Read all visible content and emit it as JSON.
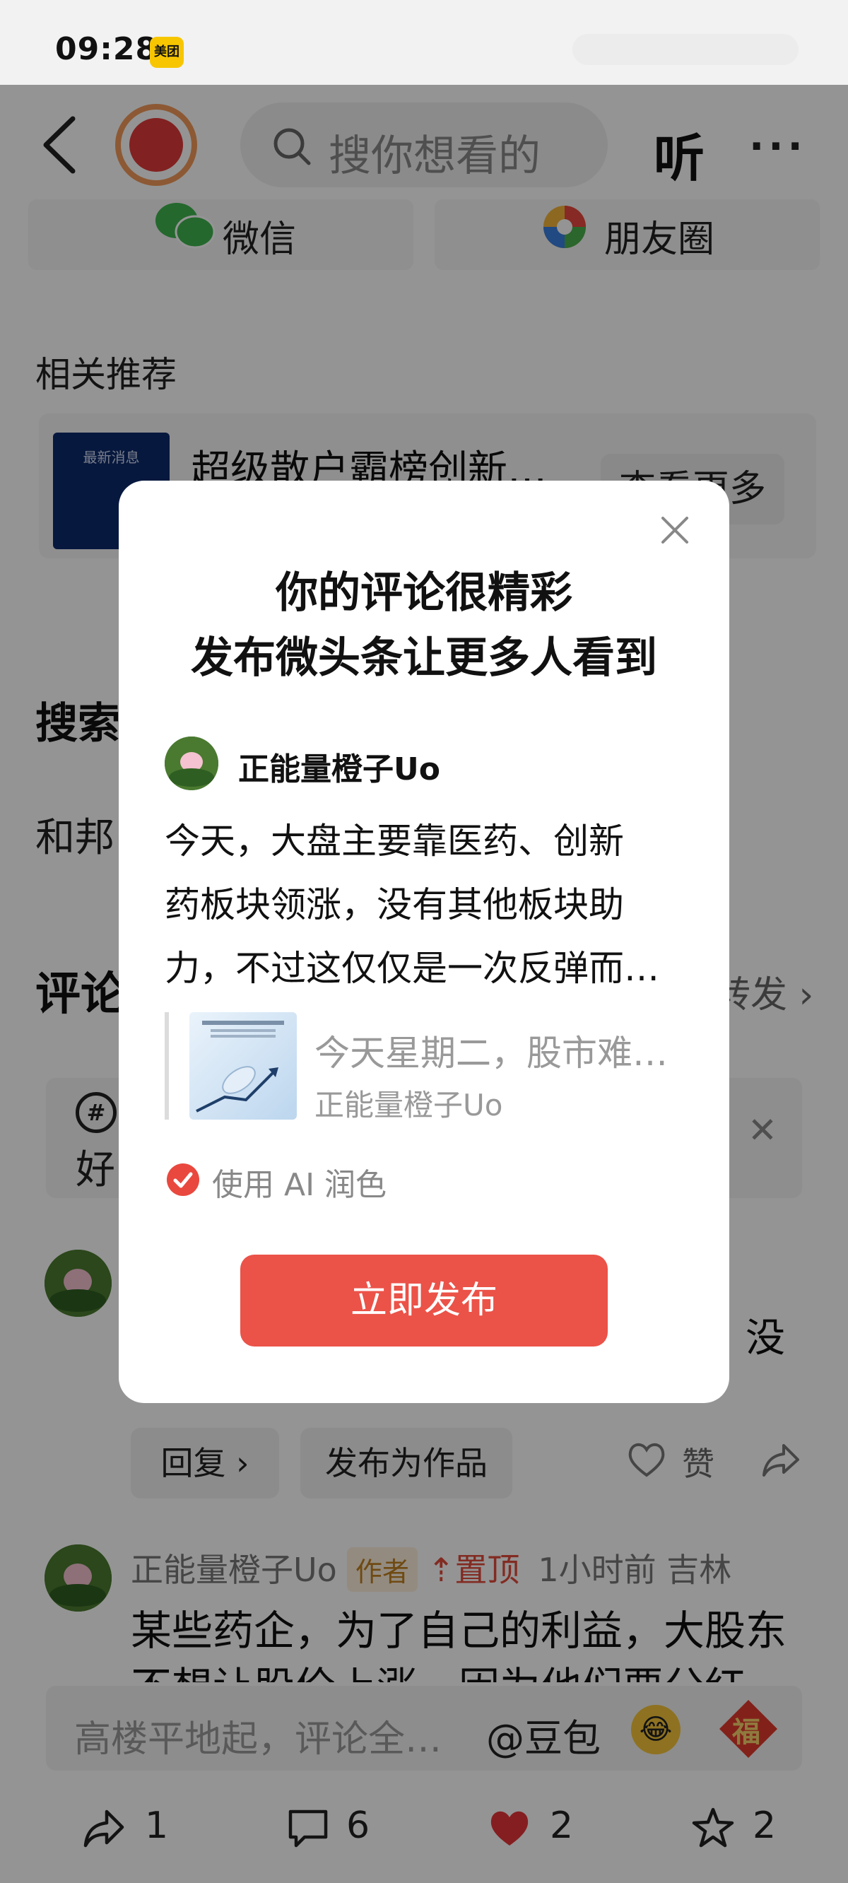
{
  "status": {
    "time": "09:28",
    "badge": "美团"
  },
  "header": {
    "search_placeholder": "搜你想看的",
    "listen_label": "听",
    "more_label": "···"
  },
  "share": {
    "wechat": "微信",
    "moments": "朋友圈"
  },
  "related": {
    "section_title": "相关推荐",
    "thumb_text": "最新消息",
    "item_title": "超级散户霸榜创新…",
    "more_label": "查看更多"
  },
  "search_section": {
    "title": "搜索",
    "hot_line": "和邦…史…"
  },
  "comments": {
    "title": "评论",
    "forward_label": "转发",
    "topic_text": "好",
    "c1": {
      "tail_text": "没",
      "reply_label": "回复",
      "publish_work_label": "发布为作品",
      "like_label": "赞"
    },
    "c2": {
      "author": "正能量橙子Uo",
      "author_tag": "作者",
      "pin_tag": "置顶",
      "time": "1小时前",
      "location": "吉林",
      "text": "某些药企，为了自己的利益，大股东",
      "text2": "不想让股价上涨，因为他们要分红"
    }
  },
  "input_bar": {
    "placeholder": "高楼平地起，评论全…",
    "at_label": "@豆包",
    "fu_label": "福"
  },
  "bottom_bar": {
    "share_count": "1",
    "comment_count": "6",
    "like_count": "2",
    "fav_count": "2"
  },
  "modal": {
    "title_line1": "你的评论很精彩",
    "title_line2": "发布微头条让更多人看到",
    "author": "正能量橙子Uo",
    "body_lines": [
      "今天，大盘主要靠医药、创新",
      "药板块领涨，没有其他板块助",
      "力，不过这仅仅是一次反弹而…"
    ],
    "quote_title": "今天星期二，股市难…",
    "quote_author": "正能量橙子Uo",
    "ai_label": "使用 AI 润色",
    "publish_label": "立即发布"
  },
  "colors": {
    "accent": "#eb5248",
    "overlay": "rgba(0,0,0,0.42)",
    "modal_bg": "#ffffff"
  }
}
